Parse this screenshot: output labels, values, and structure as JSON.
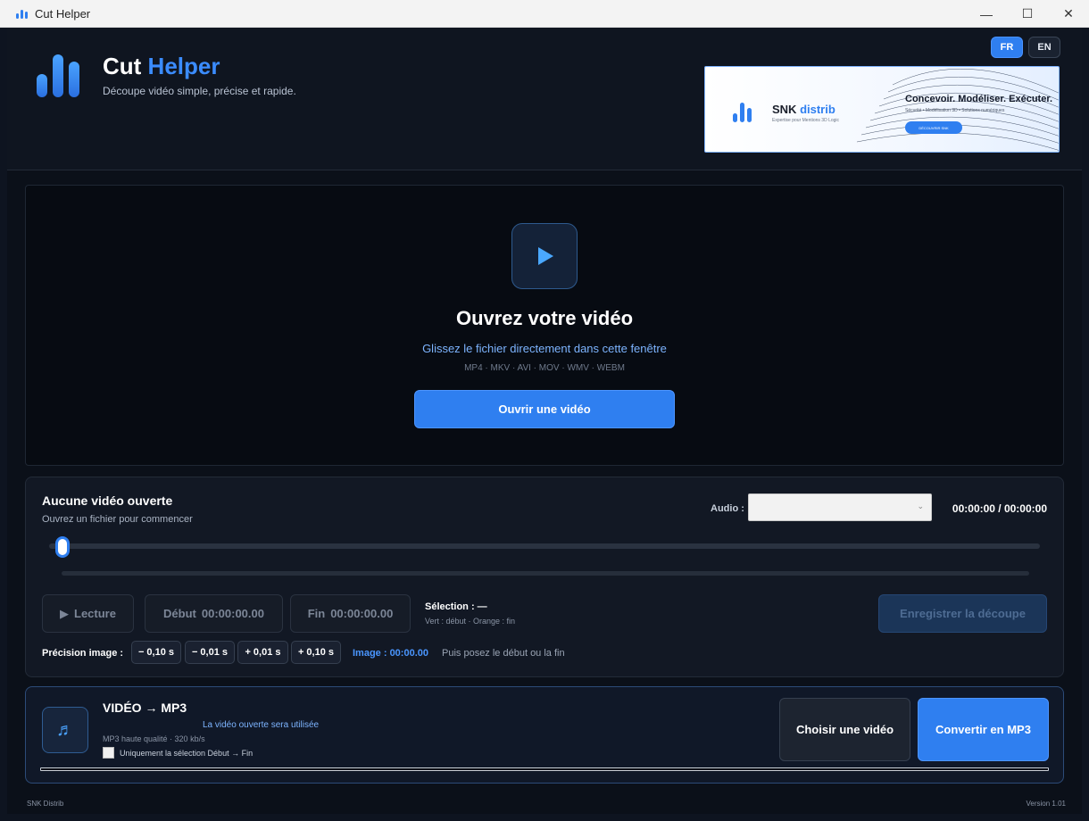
{
  "window": {
    "title": "Cut Helper",
    "minimize": "—",
    "maximize": "☐",
    "close": "✕"
  },
  "header": {
    "brand_main": "Cut ",
    "brand_accent": "Helper",
    "tagline": "Découpe vidéo simple, précise et rapide.",
    "lang_fr": "FR",
    "lang_en": "EN",
    "active_language": "FR"
  },
  "banner": {
    "brand_main": "SNK ",
    "brand_accent": "distrib",
    "brand_sub": "Expertise pour Mentions 3D Logic",
    "headline": "Concevoir. Modéliser. Exécuter.",
    "services": "Sécurité • Modélisation 3D • Solutions numériques",
    "cta": "DÉCOUVRIR SNK"
  },
  "dropzone": {
    "title": "Ouvrez votre vidéo",
    "subtitle": "Glissez le fichier directement dans cette fenêtre",
    "formats": "MP4 · MKV · AVI · MOV · WMV · WEBM",
    "open_button": "Ouvrir une vidéo"
  },
  "editor": {
    "title": "Aucune vidéo ouverte",
    "subtitle": "Ouvrez un fichier pour commencer",
    "audio_label": "Audio :",
    "audio_value": "",
    "timecode": "00:00:00 / 00:00:00",
    "playhead_fraction": 0,
    "play_button": "Lecture",
    "start_label": "Début",
    "start_time": "00:00:00.00",
    "end_label": "Fin",
    "end_time": "00:00:00.00",
    "selection_label": "Sélection : —",
    "selection_hint": "Vert : début · Orange : fin",
    "save_button": "Enregistrer la découpe",
    "precision_label": "Précision image :",
    "steps": [
      "− 0,10 s",
      "− 0,01 s",
      "+ 0,01 s",
      "+ 0,10 s"
    ],
    "frame_label": "Image : 00:00.00",
    "frame_hint": "Puis posez le début ou la fin"
  },
  "mp3": {
    "title": "VIDÉO → MP3",
    "note": "La vidéo ouverte sera utilisée",
    "quality": "MP3 haute qualité · 320 kb/s",
    "checkbox_label": "Uniquement la sélection Début → Fin",
    "checkbox_checked": false,
    "choose_button": "Choisir une vidéo",
    "convert_button": "Convertir en MP3",
    "progress": 0
  },
  "footer": {
    "left": "SNK Distrib",
    "right": "Version 1.01"
  },
  "colors": {
    "accent": "#2f7ff0",
    "background": "#0b1019",
    "panel": "#121824"
  }
}
